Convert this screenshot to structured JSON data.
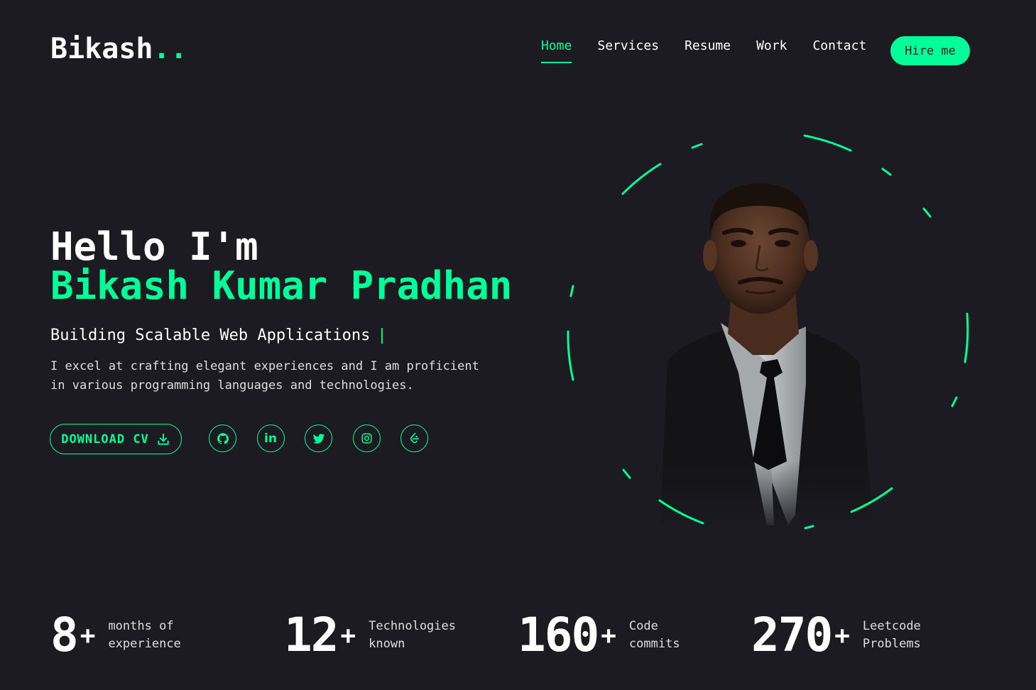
{
  "header": {
    "logo_text": "Bikash",
    "logo_suffix": "..",
    "nav": [
      {
        "label": "Home",
        "active": true
      },
      {
        "label": "Services",
        "active": false
      },
      {
        "label": "Resume",
        "active": false
      },
      {
        "label": "Work",
        "active": false
      },
      {
        "label": "Contact",
        "active": false
      }
    ],
    "hire_label": "Hire me"
  },
  "hero": {
    "greeting": "Hello I'm",
    "name": "Bikash Kumar Pradhan",
    "tagline": "Building Scalable Web Applications",
    "cursor": "|",
    "description_line1": "I excel at crafting elegant experiences and I am proficient",
    "description_line2": "in various programming languages and technologies.",
    "download_label": "DOWNLOAD CV",
    "socials": [
      "github-icon",
      "linkedin-icon",
      "twitter-icon",
      "instagram-icon",
      "leetcode-icon"
    ],
    "linkedin_text": "in"
  },
  "stats": [
    {
      "number": "8",
      "plus": "+",
      "label_line1": "months of",
      "label_line2": "experience"
    },
    {
      "number": "12",
      "plus": "+",
      "label_line1": "Technologies",
      "label_line2": "known"
    },
    {
      "number": "160",
      "plus": "+",
      "label_line1": "Code",
      "label_line2": "commits"
    },
    {
      "number": "270",
      "plus": "+",
      "label_line1": "Leetcode",
      "label_line2": "Problems"
    }
  ],
  "colors": {
    "background": "#1c1b22",
    "accent": "#00ff99",
    "text": "#ffffff"
  }
}
